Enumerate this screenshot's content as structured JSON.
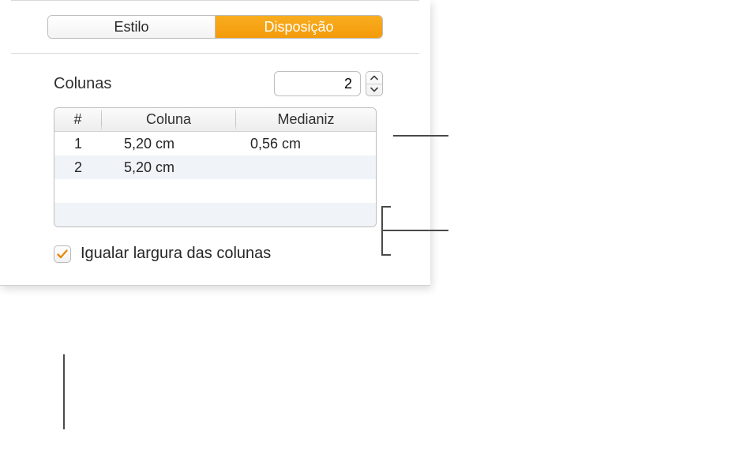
{
  "tabs": {
    "style": "Estilo",
    "layout": "Disposição"
  },
  "columns": {
    "label": "Colunas",
    "count": "2"
  },
  "table": {
    "headers": {
      "num": "#",
      "col": "Coluna",
      "gutter": "Medianiz"
    },
    "rows": [
      {
        "num": "1",
        "col": "5,20 cm",
        "gutter": "0,56 cm"
      },
      {
        "num": "2",
        "col": "5,20 cm",
        "gutter": ""
      }
    ]
  },
  "equal_width": {
    "label": "Igualar largura das colunas",
    "checked": true
  },
  "colors": {
    "accent": "#f5a623"
  }
}
